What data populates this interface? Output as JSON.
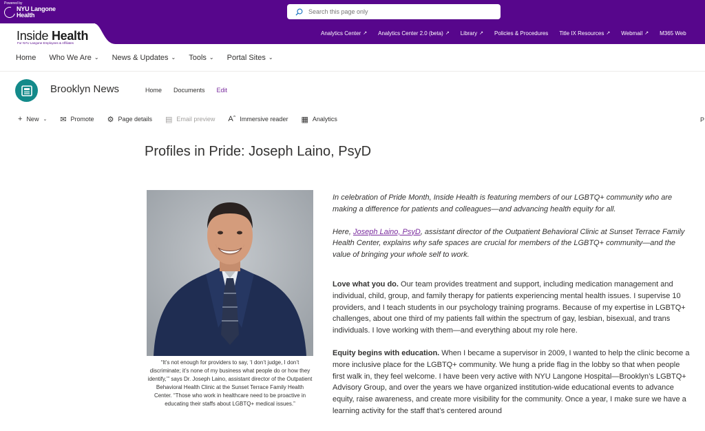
{
  "logo": {
    "powered": "Powered by",
    "line1": "NYU Langone",
    "line2": "Health"
  },
  "search": {
    "placeholder": "Search this page only"
  },
  "hub": {
    "title_light": "Inside ",
    "title_bold": "Health",
    "subtitle": "For NYU Langone Employees & Affiliates",
    "links": [
      {
        "label": "Analytics Center",
        "external": true
      },
      {
        "label": "Analytics Center 2.0 (beta)",
        "external": true
      },
      {
        "label": "Library",
        "external": true
      },
      {
        "label": "Policies & Procedures",
        "external": false
      },
      {
        "label": "Title IX Resources",
        "external": true
      },
      {
        "label": "Webmail",
        "external": true
      },
      {
        "label": "M365 Web",
        "external": false
      }
    ]
  },
  "nav": [
    {
      "label": "Home",
      "dropdown": false
    },
    {
      "label": "Who We Are",
      "dropdown": true
    },
    {
      "label": "News & Updates",
      "dropdown": true
    },
    {
      "label": "Tools",
      "dropdown": true
    },
    {
      "label": "Portal Sites",
      "dropdown": true
    }
  ],
  "site": {
    "title": "Brooklyn News",
    "nav": [
      "Home",
      "Documents",
      "Edit"
    ]
  },
  "commands": [
    {
      "icon": "plus-icon",
      "label": "New",
      "dropdown": true,
      "disabled": false
    },
    {
      "icon": "promote-icon",
      "label": "Promote",
      "disabled": false
    },
    {
      "icon": "gear-icon",
      "label": "Page details",
      "disabled": false
    },
    {
      "icon": "email-icon",
      "label": "Email preview",
      "disabled": true
    },
    {
      "icon": "reader-icon",
      "label": "Immersive reader",
      "disabled": false
    },
    {
      "icon": "analytics-icon",
      "label": "Analytics",
      "disabled": false
    }
  ],
  "command_right": "P",
  "article": {
    "title": "Profiles in Pride: Joseph Laino, PsyD",
    "caption": "“It’s not enough for providers to say, ‘I don’t judge, I don’t discriminate; it’s none of my business what people do or how they identify,’” says Dr. Joseph Laino, assistant director of the Outpatient Behavioral Health Clinic at the Sunset Terrace Family Health Center. “Those who work in healthcare need to be proactive in educating their staffs about LGBTQ+ medical issues.”",
    "intro1": "In celebration of Pride Month, Inside Health is featuring members of our LGBTQ+ community who are making a difference for patients and colleagues—and advancing health equity for all.",
    "intro2_pre": "Here, ",
    "intro2_link": "Joseph Laino, PsyD",
    "intro2_post": ", assistant director of the Outpatient Behavioral Clinic at Sunset Terrace Family Health Center, explains why safe spaces are crucial for members of the LGBTQ+ community—and the value of bringing your whole self to work.",
    "p1_bold": "Love what you do.",
    "p1_text": " Our team provides treatment and support, including medication management and individual, child, group, and family therapy for patients experiencing mental health issues. I supervise 10 providers, and I teach students in our psychology training programs. Because of my expertise in LGBTQ+ challenges, about one third of my patients fall within the spectrum of gay, lesbian, bisexual, and trans individuals. I love working with them—and everything about my role here.",
    "p2_bold": "Equity begins with education.",
    "p2_text": " When I became a supervisor in 2009, I wanted to help the clinic become a more inclusive place for the LGBTQ+ community. We hung a pride flag in the lobby so that when people first walk in, they feel welcome. I have been very active with NYU Langone Hospital—Brooklyn’s LGBTQ+ Advisory Group, and over the years we have organized institution-wide educational events to advance equity, raise awareness, and create more visibility for the community. Once a year, I make sure we have a learning activity for the staff that’s centered around"
  },
  "colors": {
    "brand": "#57068c",
    "site_icon": "#138a8a",
    "link": "#7a2c9e"
  }
}
